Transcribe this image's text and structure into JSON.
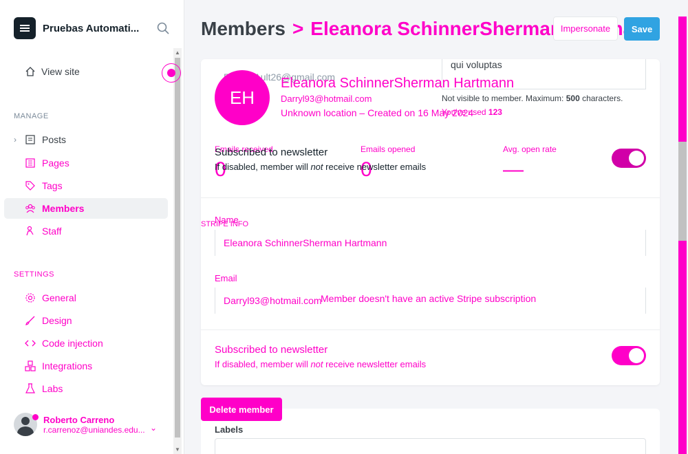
{
  "sidebar": {
    "brand": "Pruebas Automati...",
    "view_site": "View site",
    "manage_label": "MANAGE",
    "settings_label": "SETTINGS",
    "manage_items": [
      "Posts",
      "Pages",
      "Tags",
      "Members",
      "Staff"
    ],
    "settings_items": [
      "General",
      "Design",
      "Code injection",
      "Integrations",
      "Labs"
    ],
    "user": {
      "name": "Roberto Carreno",
      "email": "r.carrenoz@uniandes.edu..."
    }
  },
  "header": {
    "title": "Members",
    "breadcrumb_sep": ">",
    "member_title": "Eleanora SchinnerSherman Hartmann",
    "impersonate": "Impersonate",
    "save": "Save"
  },
  "member": {
    "initials": "EH",
    "ghost_email": "Reese.Ault26@gmail.com",
    "name": "Eleanora SchinnerSherman Hartmann",
    "email": "Darryl93@hotmail.com",
    "meta": "Unknown location – Created on 16 May 2024"
  },
  "note": {
    "value": "qui voluptas",
    "help_prefix": "Not visible to member. Maximum: ",
    "help_max": "500",
    "help_suffix": " characters.",
    "count_prefix": "You've used ",
    "count": "123"
  },
  "stats": [
    {
      "label": "Emails received",
      "value": "0"
    },
    {
      "label": "Emails opened",
      "value": "0"
    },
    {
      "label": "Avg. open rate",
      "value": "—"
    }
  ],
  "newsletter": {
    "title": "Subscribed to newsletter",
    "desc_prefix": "If disabled, member will ",
    "desc_em": "not",
    "desc_suffix": " receive newsletter emails"
  },
  "form": {
    "name_label": "Name",
    "name_value": "Eleanora SchinnerSherman Hartmann",
    "email_label": "Email",
    "email_value": "Darryl93@hotmail.com",
    "stripe_label": "STRIPE INFO",
    "stripe_text": "Member doesn't have an active Stripe subscription"
  },
  "actions": {
    "delete": "Delete member"
  },
  "labels_section": {
    "label": "Labels"
  },
  "colors": {
    "accent": "#ff00c8",
    "save": "#30a3e2",
    "dark": "#15212a"
  }
}
